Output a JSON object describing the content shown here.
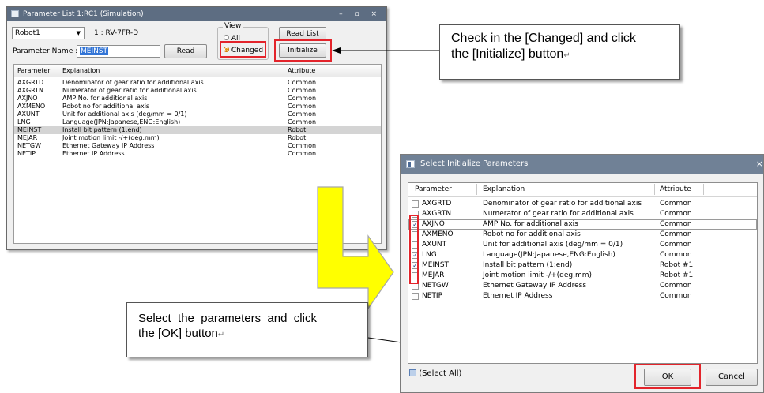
{
  "window1": {
    "title": "Parameter List 1:RC1  (Simulation)",
    "controls": "– ▫ ×",
    "robot_select": "Robot1",
    "robot_model": "1 : RV-7FR-D",
    "param_name_label": "Parameter Name :",
    "param_name_value": "MEINST",
    "read_button": "Read",
    "view_group_label": "View",
    "view_all": "All",
    "view_changed": "Changed",
    "read_list_button": "Read List",
    "initialize_button": "Initialize",
    "columns": [
      "Parameter",
      "Explanation",
      "Attribute"
    ],
    "rows": [
      {
        "param": "AXGRTD",
        "explanation": "Denominator of gear ratio for additional axis",
        "attribute": "Common"
      },
      {
        "param": "AXGRTN",
        "explanation": "Numerator of gear ratio for additional axis",
        "attribute": "Common"
      },
      {
        "param": "AXJNO",
        "explanation": "AMP No. for additional axis",
        "attribute": "Common"
      },
      {
        "param": "AXMENO",
        "explanation": "Robot no for additional axis",
        "attribute": "Common"
      },
      {
        "param": "AXUNT",
        "explanation": "Unit for additional axis (deg/mm = 0/1)",
        "attribute": "Common"
      },
      {
        "param": "LNG",
        "explanation": "Language(JPN:Japanese,ENG:English)",
        "attribute": "Common"
      },
      {
        "param": "MEINST",
        "explanation": "Install bit pattern (1:end)",
        "attribute": "Robot"
      },
      {
        "param": "MEJAR",
        "explanation": "Joint motion limit -/+(deg,mm)",
        "attribute": "Robot"
      },
      {
        "param": "NETGW",
        "explanation": "Ethernet Gateway IP Address",
        "attribute": "Common"
      },
      {
        "param": "NETIP",
        "explanation": "Ethernet IP Address",
        "attribute": "Common"
      }
    ]
  },
  "callout_top": {
    "line1": "Check in the [Changed] and click",
    "line2": "the [Initialize] button"
  },
  "callout_bottom": {
    "line1": "Select  the  parameters  and  click",
    "line2": "the [OK] button"
  },
  "window2": {
    "title": "Select Initialize Parameters",
    "close": "×",
    "columns": [
      "Parameter",
      "Explanation",
      "Attribute"
    ],
    "rows": [
      {
        "param": "AXGRTD",
        "explanation": "Denominator of gear ratio for additional axis",
        "attribute": "Common",
        "checked": false
      },
      {
        "param": "AXGRTN",
        "explanation": "Numerator of gear ratio for additional axis",
        "attribute": "Common",
        "checked": false
      },
      {
        "param": "AXJNO",
        "explanation": "AMP No. for additional axis",
        "attribute": "Common",
        "checked": true
      },
      {
        "param": "AXMENO",
        "explanation": "Robot no for additional axis",
        "attribute": "Common",
        "checked": false
      },
      {
        "param": "AXUNT",
        "explanation": "Unit for additional axis (deg/mm = 0/1)",
        "attribute": "Common",
        "checked": false
      },
      {
        "param": "LNG",
        "explanation": "Language(JPN:Japanese,ENG:English)",
        "attribute": "Common",
        "checked": true
      },
      {
        "param": "MEINST",
        "explanation": "Install bit pattern (1:end)",
        "attribute": "Robot #1",
        "checked": true
      },
      {
        "param": "MEJAR",
        "explanation": "Joint motion limit -/+(deg,mm)",
        "attribute": "Robot #1",
        "checked": false
      },
      {
        "param": "NETGW",
        "explanation": "Ethernet Gateway IP Address",
        "attribute": "Common",
        "checked": false
      },
      {
        "param": "NETIP",
        "explanation": "Ethernet IP Address",
        "attribute": "Common",
        "checked": false
      }
    ],
    "select_all": "(Select All)",
    "ok_button": "OK",
    "cancel_button": "Cancel"
  },
  "colors": {
    "highlight_red": "#e3242b",
    "arrow_yellow": "#ffff00",
    "title_bar": "#5d6d82"
  }
}
